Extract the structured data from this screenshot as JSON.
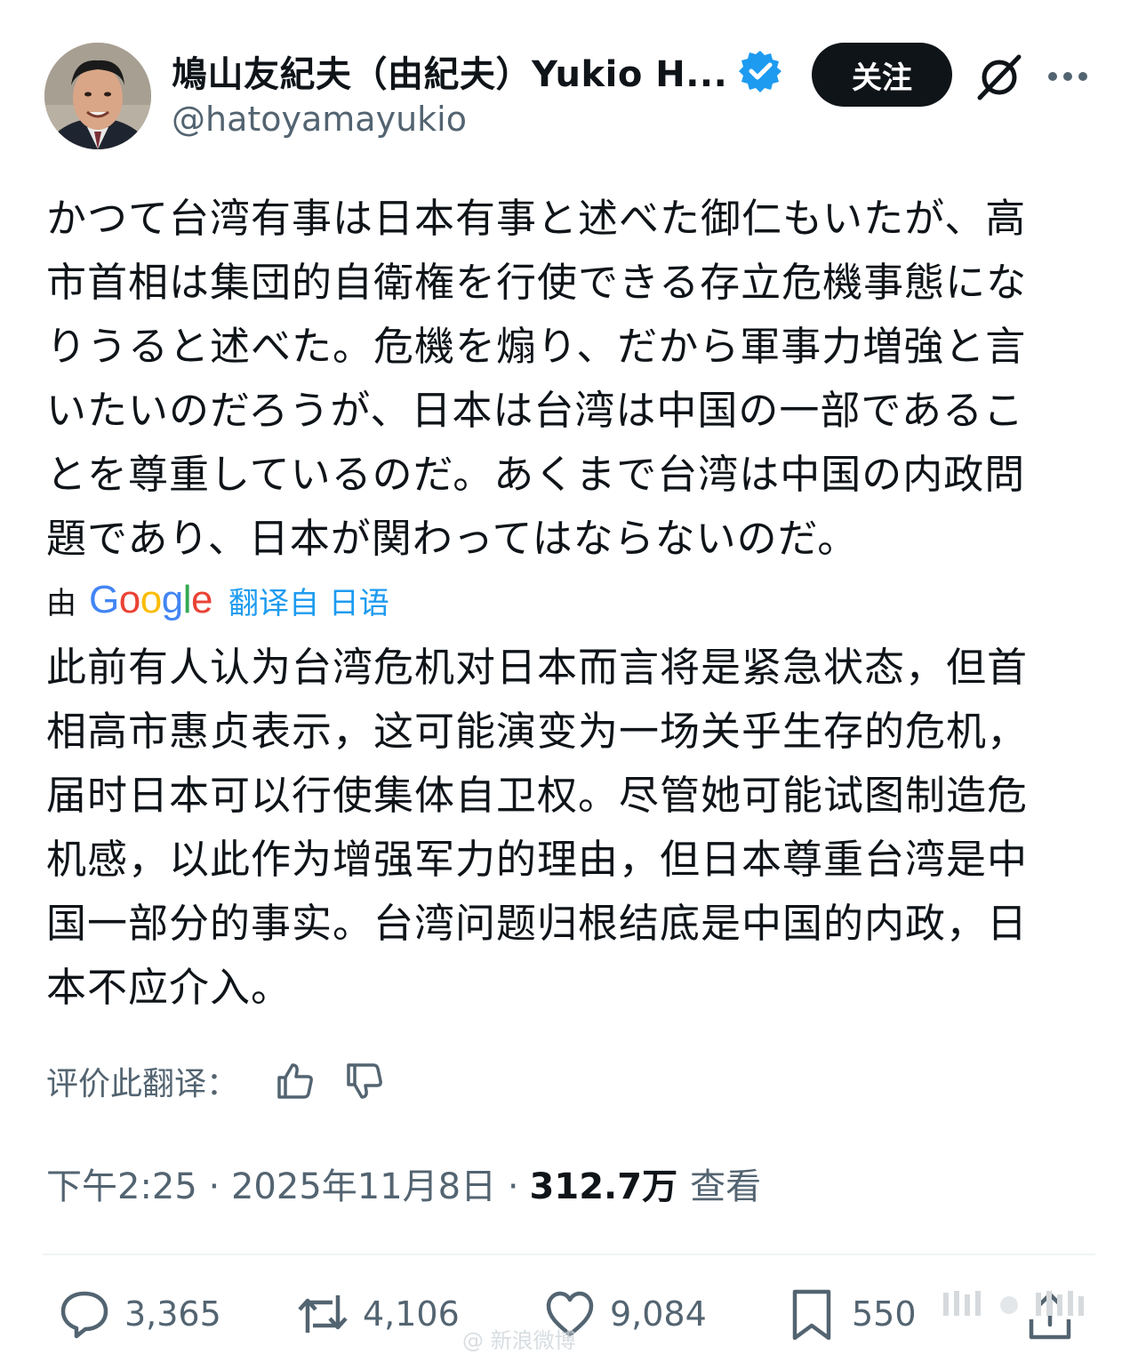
{
  "header": {
    "display_name": "鳩山友紀夫（由紀夫）Yukio H...",
    "handle": "@hatoyamayukio",
    "follow_label": "关注",
    "icons": {
      "verified": "verified-badge-icon",
      "grok": "grok-icon",
      "more": "more-icon"
    },
    "colors": {
      "verified": "#1d9bf0",
      "follow_bg": "#0f1419"
    }
  },
  "post": {
    "original_text": "かつて台湾有事は日本有事と述べた御仁もいたが、高\n市首相は集団的自衛権を行使できる存立危機事態にな\nりうると述べた。危機を煽り、だから軍事力増強と言\nいたいのだろうが、日本は台湾は中国の一部であるこ\nとを尊重しているのだ。あくまで台湾は中国の内政問\n題であり、日本が関わってはならないのだ。",
    "translation": {
      "prefix": "由",
      "provider": "Google",
      "suffix": "翻译自 日语",
      "text": "此前有人认为台湾危机对日本而言将是紧急状态，但首\n相高市惠贞表示，这可能演变为一场关乎生存的危机，\n届时日本可以行使集体自卫权。尽管她可能试图制造危\n机感，以此作为增强军力的理由，但日本尊重台湾是中\n国一部分的事实。台湾问题归根结底是中国的内政，日\n本不应介入。"
    },
    "rate_label": "评价此翻译：",
    "meta": {
      "time_date": "下午2:25 · 2025年11月8日 ·",
      "views_count": "312.7万",
      "views_label": "查看"
    }
  },
  "actions": {
    "replies": "3,365",
    "reposts": "4,106",
    "likes": "9,084",
    "bookmarks": "550"
  },
  "watermark": "@ 新浪微博"
}
